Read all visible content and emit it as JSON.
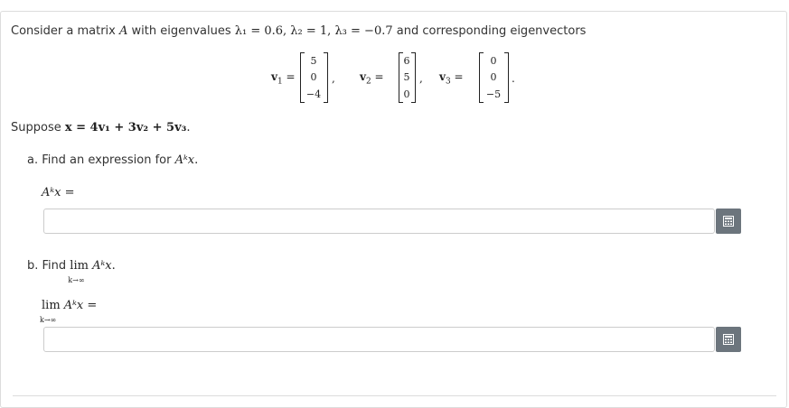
{
  "question": {
    "intro_prefix": "Consider a matrix ",
    "intro_matrix": "A",
    "intro_middle": " with eigenvalues ",
    "eigenvalues": "λ₁ = 0.6, λ₂ = 1, λ₃ = −0.7",
    "intro_suffix": " and corresponding eigenvectors",
    "vectors": [
      {
        "label": "v",
        "index": "1",
        "entries": [
          "5",
          "0",
          "−4"
        ],
        "punct": ","
      },
      {
        "label": "v",
        "index": "2",
        "entries": [
          "6",
          "5",
          "0"
        ],
        "punct": ","
      },
      {
        "label": "v",
        "index": "3",
        "entries": [
          "0",
          "0",
          "−5"
        ],
        "punct": "."
      }
    ],
    "suppose_text": "Suppose ",
    "suppose_math": "x = 4v₁ + 3v₂ + 5v₃",
    "suppose_end": "."
  },
  "part_a": {
    "prompt": "a. Find an expression for ",
    "prompt_math": "Aᵏx",
    "prompt_end": ".",
    "answer_label": "Aᵏx =",
    "answer_value": ""
  },
  "part_b": {
    "prompt": "b. Find ",
    "lim": "lim",
    "lim_sub": "k→∞",
    "prompt_math": "Aᵏx",
    "prompt_end": ".",
    "answer_lim": "lim",
    "answer_lim_sub": "k→∞",
    "answer_label": "Aᵏx =",
    "answer_value": ""
  },
  "icons": {
    "calculator": "calculator-icon"
  },
  "colors": {
    "button": "#6c757d",
    "border": "#cccccc"
  }
}
